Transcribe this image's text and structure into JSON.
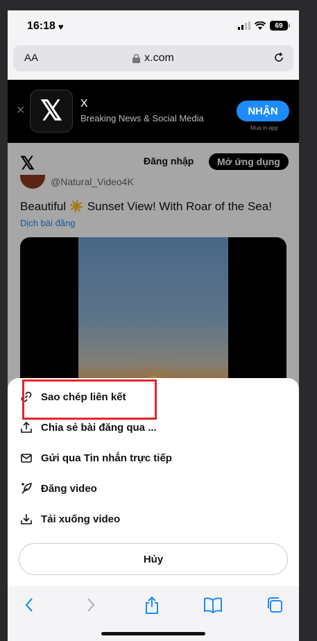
{
  "status": {
    "time": "16:18",
    "battery": "69"
  },
  "browser": {
    "text_size_label": "AA",
    "url": "x.com"
  },
  "app_banner": {
    "name": "X",
    "subtitle": "Breaking News & Social Media",
    "get_label": "NHẬN",
    "in_app_label": "Mua in-app"
  },
  "header": {
    "login_label": "Đăng nhập",
    "open_app_label": "Mở ứng dụng"
  },
  "post": {
    "handle": "@Natural_Video4K",
    "text": "Beautiful ☀️ Sunset View! With Roar of the Sea!",
    "translate_label": "Dịch bài đăng"
  },
  "share_sheet": {
    "items": [
      {
        "label": "Sao chép liên kết",
        "icon": "link-icon"
      },
      {
        "label": "Chia sẻ bài đăng qua ...",
        "icon": "share-icon"
      },
      {
        "label": "Gửi qua Tin nhắn trực tiếp",
        "icon": "mail-icon"
      },
      {
        "label": "Đăng video",
        "icon": "feather-icon"
      },
      {
        "label": "Tải xuống video",
        "icon": "download-icon"
      }
    ],
    "cancel_label": "Hủy"
  },
  "colors": {
    "accent": "#1d8cf8",
    "highlight": "#e3252a"
  }
}
